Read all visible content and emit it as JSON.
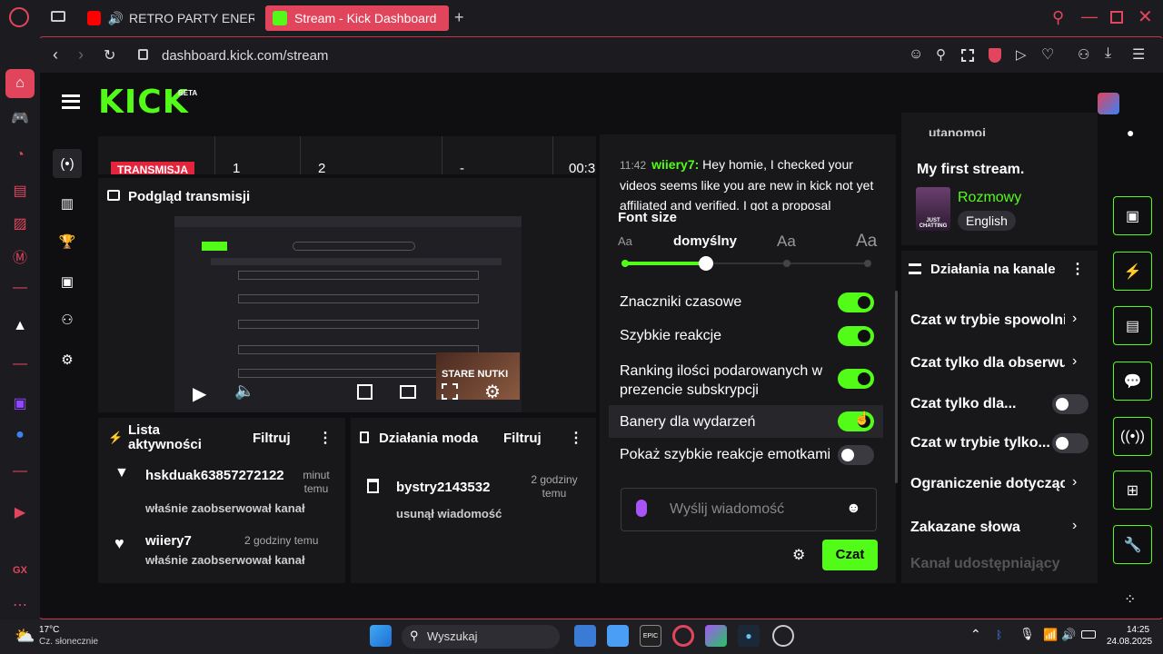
{
  "browser": {
    "tabs": [
      {
        "label": "RETRO PARTY ENERG",
        "favicon": "youtube-icon"
      },
      {
        "label": "Stream - Kick Dashboard",
        "favicon": "kick-icon"
      }
    ],
    "url": "dashboard.kick.com/stream"
  },
  "kick": {
    "logo": "KICK",
    "beta": "BETA"
  },
  "stats": {
    "badge": "TRANSMISJA",
    "values": [
      "1",
      "2",
      "-",
      "00:3"
    ]
  },
  "preview": {
    "title": "Podgląd transmisji",
    "overlay_text": "STARE NUTKI"
  },
  "activity": {
    "title": "Lista aktywności",
    "filter": "Filtruj",
    "items": [
      {
        "user": "hskduak63857272122",
        "time": "minut temu",
        "action": "właśnie zaobserwował kanał"
      },
      {
        "user": "wiiery7",
        "time": "2 godziny temu",
        "action": "właśnie zaobserwował kanał"
      }
    ]
  },
  "mod": {
    "title": "Działania moda",
    "filter": "Filtruj",
    "items": [
      {
        "user": "bystry2143532",
        "time": "2 godziny temu",
        "action": "usunął wiadomość"
      }
    ]
  },
  "chat": {
    "message_time": "11:42",
    "message_user": "wiiery7:",
    "message_text": "Hey homie, I checked your videos seems like you are new in kick not yet affiliated and verified. I got a proposal",
    "font_size_label": "Font size",
    "font_small": "Aa",
    "font_default": "domyślny",
    "font_large": "Aa",
    "font_xlarge": "Aa",
    "font_size_level": 0.33,
    "settings": [
      {
        "label": "Znaczniki czasowe",
        "on": true
      },
      {
        "label": "Szybkie reakcje",
        "on": true
      },
      {
        "label": "Ranking ilości podarowanych w prezencie subskrypcji",
        "on": true
      },
      {
        "label": "Banery dla wydarzeń",
        "on": true
      },
      {
        "label": "Pokaż szybkie reakcje emotkami",
        "on": false
      }
    ],
    "input_placeholder": "Wyślij wiadomość",
    "send_button": "Czat"
  },
  "stream_info": {
    "partial_top": "utanomoj",
    "title": "My first stream.",
    "category": "Rozmowy",
    "category_thumb": "JUST CHATTING",
    "language": "English"
  },
  "channel_actions": {
    "title": "Działania na kanale",
    "items": [
      {
        "label": "Czat w trybie spowolni",
        "type": "link"
      },
      {
        "label": "Czat tylko dla obserwu",
        "type": "link"
      },
      {
        "label": "Czat tylko dla...",
        "type": "toggle"
      },
      {
        "label": "Czat w trybie tylko...",
        "type": "toggle"
      },
      {
        "label": "Ograniczenie dotycząc",
        "type": "link"
      },
      {
        "label": "Zakazane słowa",
        "type": "link"
      },
      {
        "label": "Kanał udostępniający",
        "type": "faded"
      }
    ]
  },
  "taskbar": {
    "weather_temp": "17°C",
    "weather_desc": "Cz. słonecznie",
    "search": "Wyszukaj",
    "time": "14:25",
    "date": "24.08.2025"
  },
  "colors": {
    "kick_green": "#53fc18",
    "opera_red": "#e0455c",
    "background": "#0f0f12",
    "panel": "#18181b"
  }
}
